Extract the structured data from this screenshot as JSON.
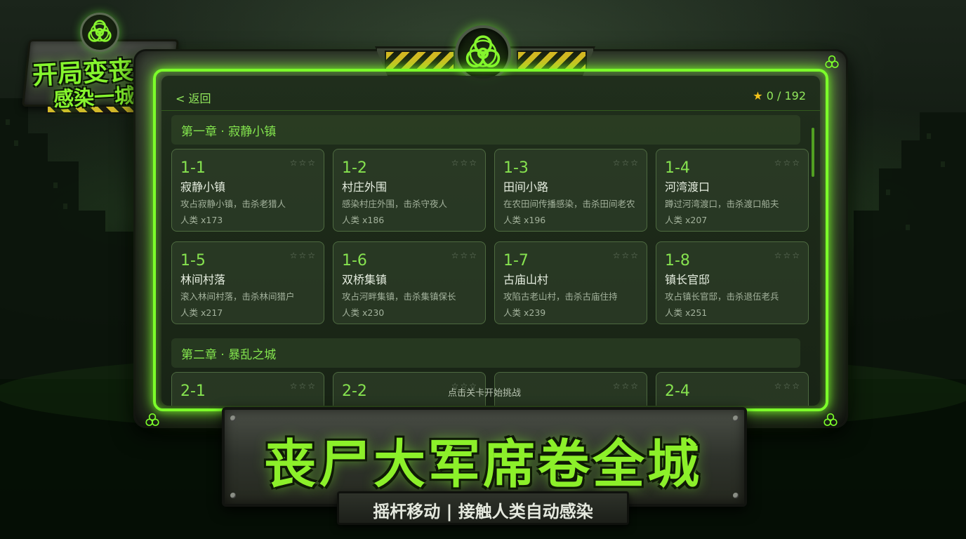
{
  "logo": {
    "line1": "开局变丧尸",
    "line2": "感染一城人"
  },
  "header": {
    "back_label": "< 返回",
    "stars_icon": "★",
    "stars_progress": "0 / 192"
  },
  "chapters": [
    {
      "title": "第一章 · 寂静小镇",
      "levels": [
        {
          "id": "1-1",
          "name": "寂静小镇",
          "desc": "攻占寂静小镇，击杀老猎人",
          "humans": "人类 x173",
          "stars": "☆☆☆"
        },
        {
          "id": "1-2",
          "name": "村庄外围",
          "desc": "感染村庄外围，击杀守夜人",
          "humans": "人类 x186",
          "stars": "☆☆☆"
        },
        {
          "id": "1-3",
          "name": "田间小路",
          "desc": "在农田间传播感染，击杀田间老农",
          "humans": "人类 x196",
          "stars": "☆☆☆"
        },
        {
          "id": "1-4",
          "name": "河湾渡口",
          "desc": "蹲过河湾渡口，击杀渡口船夫",
          "humans": "人类 x207",
          "stars": "☆☆☆"
        },
        {
          "id": "1-5",
          "name": "林间村落",
          "desc": "滚入林间村落，击杀林间猎户",
          "humans": "人类 x217",
          "stars": "☆☆☆"
        },
        {
          "id": "1-6",
          "name": "双桥集镇",
          "desc": "攻占河畔集镇，击杀集镇保长",
          "humans": "人类 x230",
          "stars": "☆☆☆"
        },
        {
          "id": "1-7",
          "name": "古庙山村",
          "desc": "攻陷古老山村，击杀古庙住持",
          "humans": "人类 x239",
          "stars": "☆☆☆"
        },
        {
          "id": "1-8",
          "name": "镇长官邸",
          "desc": "攻占镇长官邸，击杀退伍老兵",
          "humans": "人类 x251",
          "stars": "☆☆☆"
        }
      ]
    },
    {
      "title": "第二章 · 暴乱之城",
      "levels": [
        {
          "id": "2-1",
          "stars": "☆☆☆"
        },
        {
          "id": "2-2",
          "stars": "☆☆☆"
        },
        {
          "id": "",
          "stars": "☆☆☆"
        },
        {
          "id": "2-4",
          "stars": "☆☆☆"
        }
      ]
    }
  ],
  "hint": "点击关卡开始挑战",
  "banner": {
    "title": "丧尸大军席卷全城",
    "subtitle": "摇杆移动 | 接触人类自动感染"
  },
  "colors": {
    "neon_green": "#7cff2a",
    "star_gold": "#f2c21b",
    "hazard_yellow": "#d8b522"
  },
  "icons": [
    "biohazard-icon",
    "star-icon",
    "back-chevron-icon"
  ]
}
